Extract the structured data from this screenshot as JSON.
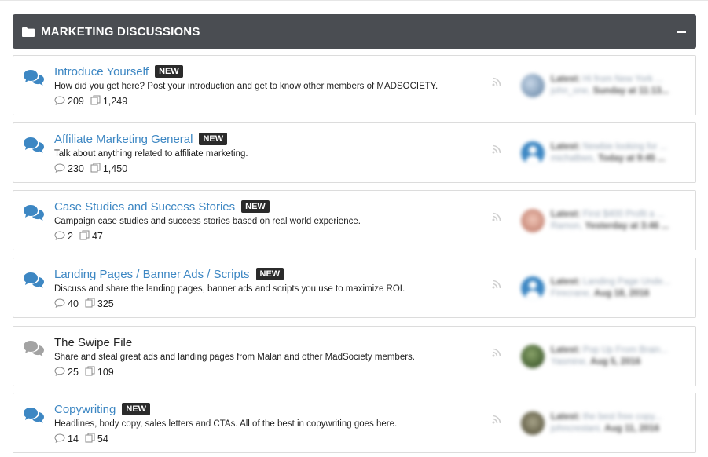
{
  "section": {
    "title": "MARKETING DISCUSSIONS",
    "folder_icon": "folder-icon",
    "collapse_icon": "minus-icon"
  },
  "forums": [
    {
      "name": "Introduce Yourself",
      "is_new": true,
      "badge": "NEW",
      "description": "How did you get here? Post your introduction and get to know other members of MADSOCIETY.",
      "threads": "209",
      "messages": "1,249",
      "latest_label": "Latest:",
      "latest_title": "Hi from New York ...",
      "latest_user": "john_one,",
      "latest_time": "Sunday at 11:13...",
      "avatar": "photo1"
    },
    {
      "name": "Affiliate Marketing General",
      "is_new": true,
      "badge": "NEW",
      "description": "Talk about anything related to affiliate marketing.",
      "threads": "230",
      "messages": "1,450",
      "latest_label": "Latest:",
      "latest_title": "Newbie looking for ...",
      "latest_user": "michalbws,",
      "latest_time": "Today at 9:45 ...",
      "avatar": "default"
    },
    {
      "name": "Case Studies and Success Stories",
      "is_new": true,
      "badge": "NEW",
      "description": "Campaign case studies and success stories based on real world experience.",
      "threads": "2",
      "messages": "47",
      "latest_label": "Latest:",
      "latest_title": "First $400 Profit a ...",
      "latest_user": "Ramon,",
      "latest_time": "Yesterday at 3:46 ...",
      "avatar": "photo2"
    },
    {
      "name": "Landing Pages / Banner Ads / Scripts",
      "is_new": true,
      "badge": "NEW",
      "description": "Discuss and share the landing pages, banner ads and scripts you use to maximize ROI.",
      "threads": "40",
      "messages": "325",
      "latest_label": "Latest:",
      "latest_title": "Landing Page Unde...",
      "latest_user": "Firecrane,",
      "latest_time": "Aug 18, 2016",
      "avatar": "default"
    },
    {
      "name": "The Swipe File",
      "is_new": false,
      "badge": "",
      "description": "Share and steal great ads and landing pages from Malan and other MadSociety members.",
      "threads": "25",
      "messages": "109",
      "latest_label": "Latest:",
      "latest_title": "Pop Up From Brain...",
      "latest_user": "Yasmine,",
      "latest_time": "Aug 5, 2016",
      "avatar": "photo3"
    },
    {
      "name": "Copywriting",
      "is_new": true,
      "badge": "NEW",
      "description": "Headlines, body copy, sales letters and CTAs. All of the best in copywriting goes here.",
      "threads": "14",
      "messages": "54",
      "latest_label": "Latest:",
      "latest_title": "the best free copy...",
      "latest_user": "johncrestani,",
      "latest_time": "Aug 11, 2016",
      "avatar": "photo4"
    }
  ],
  "colors": {
    "header_bg": "#4a4d52",
    "link": "#3d87c3",
    "badge_bg": "#2b2b2b",
    "bubble_new": "#3d87c3",
    "bubble_read": "#a3a3a3"
  }
}
